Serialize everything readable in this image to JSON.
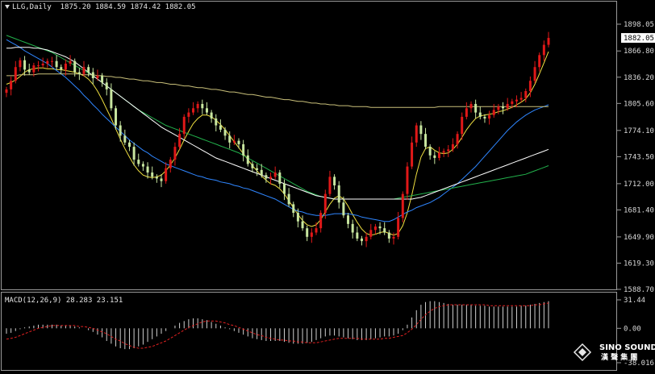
{
  "header": {
    "symbol": "LLG,Daily",
    "ohlc": "1875.20 1884.59 1874.42 1882.05"
  },
  "macd": {
    "label": "MACD(12,26,9) 28.283 23.151",
    "ticks": [
      "31.44",
      "0.00",
      "-38.016"
    ],
    "values": [
      31.44,
      0.0,
      -38.016
    ]
  },
  "price_axis": {
    "ticks": [
      "1898.05",
      "1866.80",
      "1836.20",
      "1805.60",
      "1774.10",
      "1743.50",
      "1712.00",
      "1681.40",
      "1649.90",
      "1619.30",
      "1588.70"
    ],
    "last_price": "1882.05"
  },
  "watermark": {
    "line1": "SINO SOUND",
    "line2": "漢 聲 集 團"
  },
  "colors": {
    "background": "#000000",
    "bull": "#e01818",
    "bear": "#c8e6a0",
    "ma_a": "#f0e040",
    "ma_b": "#2f86ff",
    "ma_c": "#22b24c",
    "ma_d": "#ffffff",
    "ma_e": "#c9c07a",
    "signal": "#e02020",
    "histogram": "#d0d0d0"
  },
  "chart_data": {
    "type": "candlestick",
    "title": "LLG,Daily",
    "ylim": [
      1588.7,
      1898.05
    ],
    "y_ticks": [
      1898.05,
      1866.8,
      1836.2,
      1805.6,
      1774.1,
      1743.5,
      1712.0,
      1681.4,
      1649.9,
      1619.3,
      1588.7
    ],
    "closes": [
      1822,
      1832,
      1848,
      1856,
      1845,
      1842,
      1850,
      1850,
      1852,
      1855,
      1855,
      1848,
      1845,
      1852,
      1855,
      1842,
      1840,
      1848,
      1842,
      1835,
      1838,
      1830,
      1822,
      1800,
      1780,
      1768,
      1760,
      1755,
      1740,
      1735,
      1732,
      1725,
      1720,
      1718,
      1715,
      1730,
      1740,
      1755,
      1770,
      1790,
      1795,
      1800,
      1805,
      1800,
      1795,
      1788,
      1780,
      1775,
      1768,
      1760,
      1762,
      1758,
      1745,
      1735,
      1730,
      1728,
      1722,
      1718,
      1720,
      1725,
      1712,
      1700,
      1688,
      1678,
      1668,
      1660,
      1650,
      1655,
      1660,
      1678,
      1700,
      1720,
      1710,
      1690,
      1675,
      1665,
      1655,
      1648,
      1645,
      1650,
      1658,
      1662,
      1660,
      1655,
      1648,
      1650,
      1672,
      1700,
      1732,
      1760,
      1780,
      1770,
      1755,
      1745,
      1742,
      1748,
      1750,
      1752,
      1758,
      1770,
      1790,
      1800,
      1805,
      1795,
      1790,
      1788,
      1792,
      1798,
      1802,
      1800,
      1805,
      1808,
      1810,
      1812,
      1820,
      1832,
      1848,
      1862,
      1874,
      1882
    ],
    "ma_series": [
      {
        "values": [
          1828,
          1830,
          1833,
          1837,
          1842,
          1845,
          1846,
          1847,
          1847,
          1846,
          1846,
          1845,
          1845,
          1844,
          1843,
          1842,
          1840,
          1838,
          1834,
          1828,
          1820,
          1810,
          1799,
          1788,
          1776,
          1764,
          1753,
          1743,
          1734,
          1727,
          1722,
          1720,
          1719,
          1720,
          1722,
          1727,
          1734,
          1742,
          1752,
          1763,
          1773,
          1782,
          1788,
          1792,
          1792,
          1790,
          1786,
          1781,
          1775,
          1768,
          1761,
          1754,
          1747,
          1740,
          1733,
          1727,
          1721,
          1716,
          1712,
          1710,
          1706,
          1700,
          1692,
          1684,
          1676,
          1669,
          1664,
          1662,
          1664,
          1670,
          1679,
          1688,
          1695,
          1698,
          1694,
          1686,
          1676,
          1667,
          1659,
          1654,
          1652,
          1653,
          1655,
          1656,
          1654,
          1652,
          1654,
          1663,
          1678,
          1699,
          1723,
          1743,
          1753,
          1755,
          1751,
          1748,
          1747,
          1748,
          1752,
          1758,
          1766,
          1775,
          1782,
          1788,
          1791,
          1792,
          1793,
          1794,
          1796,
          1797,
          1799,
          1801,
          1804,
          1807,
          1811,
          1818,
          1828,
          1840,
          1853,
          1866
        ]
      },
      {
        "values": [
          1880,
          1877,
          1874,
          1871,
          1867,
          1864,
          1861,
          1858,
          1855,
          1852,
          1848,
          1844,
          1840,
          1836,
          1831,
          1826,
          1821,
          1815,
          1810,
          1804,
          1799,
          1793,
          1788,
          1783,
          1778,
          1773,
          1768,
          1763,
          1759,
          1755,
          1751,
          1748,
          1744,
          1741,
          1738,
          1735,
          1733,
          1731,
          1729,
          1727,
          1725,
          1723,
          1721,
          1720,
          1718,
          1717,
          1716,
          1714,
          1713,
          1712,
          1710,
          1709,
          1707,
          1706,
          1704,
          1702,
          1700,
          1698,
          1696,
          1694,
          1691,
          1688,
          1685,
          1682,
          1680,
          1679,
          1677,
          1676,
          1675,
          1675,
          1675,
          1676,
          1677,
          1677,
          1677,
          1677,
          1676,
          1675,
          1673,
          1672,
          1671,
          1670,
          1669,
          1668,
          1668,
          1670,
          1673,
          1676,
          1679,
          1681,
          1684,
          1686,
          1688,
          1690,
          1693,
          1696,
          1700,
          1704,
          1708,
          1712,
          1717,
          1722,
          1727,
          1732,
          1738,
          1744,
          1750,
          1756,
          1762,
          1768,
          1774,
          1779,
          1784,
          1788,
          1792,
          1795,
          1798,
          1800,
          1802,
          1804
        ]
      },
      {
        "values": [
          1885,
          1883,
          1881,
          1879,
          1877,
          1875,
          1873,
          1871,
          1869,
          1867,
          1865,
          1862,
          1859,
          1856,
          1853,
          1850,
          1847,
          1844,
          1841,
          1838,
          1834,
          1830,
          1826,
          1822,
          1818,
          1814,
          1810,
          1806,
          1802,
          1798,
          1795,
          1792,
          1789,
          1786,
          1783,
          1780,
          1778,
          1776,
          1774,
          1772,
          1770,
          1768,
          1766,
          1764,
          1762,
          1760,
          1758,
          1756,
          1754,
          1752,
          1750,
          1748,
          1745,
          1742,
          1739,
          1736,
          1733,
          1730,
          1727,
          1724,
          1721,
          1718,
          1715,
          1712,
          1709,
          1706,
          1703,
          1701,
          1699,
          1697,
          1696,
          1695,
          1694,
          1694,
          1694,
          1694,
          1694,
          1694,
          1694,
          1694,
          1694,
          1694,
          1694,
          1694,
          1694,
          1694,
          1695,
          1696,
          1697,
          1698,
          1699,
          1700,
          1701,
          1702,
          1703,
          1704,
          1705,
          1706,
          1707,
          1708,
          1709,
          1710,
          1711,
          1712,
          1713,
          1714,
          1715,
          1716,
          1717,
          1718,
          1719,
          1720,
          1721,
          1722,
          1723,
          1725,
          1727,
          1729,
          1731,
          1733
        ]
      },
      {
        "values": [
          1870,
          1870,
          1871,
          1871,
          1871,
          1871,
          1870,
          1870,
          1869,
          1868,
          1866,
          1864,
          1862,
          1860,
          1857,
          1854,
          1850,
          1846,
          1842,
          1838,
          1834,
          1830,
          1826,
          1822,
          1818,
          1814,
          1810,
          1806,
          1802,
          1798,
          1794,
          1790,
          1786,
          1782,
          1778,
          1775,
          1772,
          1769,
          1766,
          1763,
          1760,
          1757,
          1754,
          1751,
          1748,
          1745,
          1742,
          1740,
          1738,
          1736,
          1734,
          1732,
          1730,
          1728,
          1726,
          1724,
          1722,
          1720,
          1718,
          1716,
          1714,
          1712,
          1710,
          1708,
          1706,
          1704,
          1702,
          1700,
          1698,
          1697,
          1696,
          1695,
          1694,
          1694,
          1694,
          1694,
          1694,
          1694,
          1694,
          1694,
          1694,
          1694,
          1694,
          1694,
          1694,
          1694,
          1694,
          1694,
          1694,
          1694,
          1695,
          1696,
          1698,
          1700,
          1702,
          1704,
          1706,
          1708,
          1710,
          1712,
          1714,
          1716,
          1718,
          1720,
          1722,
          1724,
          1726,
          1728,
          1730,
          1732,
          1734,
          1736,
          1738,
          1740,
          1742,
          1744,
          1746,
          1748,
          1750,
          1752
        ]
      },
      {
        "values": [
          1838,
          1838,
          1838,
          1839,
          1839,
          1839,
          1839,
          1840,
          1840,
          1840,
          1840,
          1840,
          1840,
          1840,
          1840,
          1840,
          1840,
          1839,
          1839,
          1839,
          1838,
          1838,
          1837,
          1837,
          1836,
          1836,
          1835,
          1834,
          1834,
          1833,
          1832,
          1832,
          1831,
          1830,
          1830,
          1829,
          1828,
          1828,
          1827,
          1826,
          1826,
          1825,
          1824,
          1824,
          1823,
          1822,
          1822,
          1821,
          1820,
          1819,
          1819,
          1818,
          1817,
          1816,
          1816,
          1815,
          1814,
          1813,
          1813,
          1812,
          1811,
          1810,
          1810,
          1809,
          1808,
          1808,
          1807,
          1806,
          1806,
          1805,
          1805,
          1804,
          1804,
          1803,
          1803,
          1803,
          1802,
          1802,
          1802,
          1802,
          1801,
          1801,
          1801,
          1801,
          1801,
          1801,
          1801,
          1801,
          1801,
          1801,
          1801,
          1801,
          1801,
          1801,
          1801,
          1802,
          1802,
          1802,
          1802,
          1802,
          1802,
          1802,
          1802,
          1802,
          1802,
          1802,
          1802,
          1802,
          1802,
          1802,
          1802,
          1802,
          1802,
          1802,
          1802,
          1802,
          1802,
          1802,
          1802,
          1802
        ]
      }
    ],
    "macd_histogram": [
      -6,
      -5,
      -3,
      -1,
      1,
      2,
      3,
      4,
      4,
      4,
      4,
      4,
      3,
      3,
      3,
      2,
      1,
      0,
      -2,
      -4,
      -7,
      -10,
      -14,
      -17,
      -20,
      -22,
      -23,
      -23,
      -22,
      -20,
      -18,
      -15,
      -12,
      -9,
      -6,
      -3,
      0,
      3,
      6,
      8,
      10,
      11,
      11,
      10,
      9,
      7,
      5,
      3,
      1,
      -1,
      -3,
      -5,
      -7,
      -9,
      -11,
      -12,
      -13,
      -14,
      -14,
      -14,
      -14,
      -15,
      -16,
      -17,
      -17,
      -17,
      -16,
      -15,
      -13,
      -11,
      -9,
      -8,
      -8,
      -9,
      -10,
      -11,
      -12,
      -13,
      -13,
      -13,
      -12,
      -11,
      -10,
      -9,
      -9,
      -8,
      -6,
      -2,
      4,
      12,
      20,
      26,
      29,
      30,
      30,
      29,
      28,
      27,
      26,
      26,
      26,
      26,
      26,
      25,
      25,
      25,
      24,
      24,
      24,
      24,
      24,
      24,
      24,
      25,
      25,
      26,
      27,
      28,
      29,
      30
    ],
    "macd_signal": [
      -12,
      -11,
      -10,
      -8,
      -6,
      -4,
      -2,
      0,
      1,
      2,
      3,
      3,
      3,
      3,
      3,
      3,
      2,
      2,
      1,
      0,
      -2,
      -4,
      -6,
      -9,
      -12,
      -14,
      -17,
      -19,
      -21,
      -22,
      -22,
      -21,
      -20,
      -18,
      -16,
      -14,
      -11,
      -8,
      -5,
      -2,
      1,
      3,
      5,
      7,
      8,
      8,
      8,
      7,
      6,
      4,
      3,
      1,
      -1,
      -3,
      -5,
      -7,
      -8,
      -10,
      -11,
      -12,
      -13,
      -13,
      -14,
      -14,
      -15,
      -15,
      -16,
      -16,
      -16,
      -15,
      -14,
      -13,
      -12,
      -11,
      -11,
      -11,
      -11,
      -11,
      -12,
      -12,
      -12,
      -12,
      -12,
      -11,
      -11,
      -10,
      -9,
      -8,
      -5,
      -1,
      4,
      10,
      15,
      19,
      22,
      24,
      25,
      26,
      26,
      26,
      26,
      26,
      26,
      26,
      26,
      26,
      25,
      25,
      25,
      25,
      25,
      25,
      25,
      25,
      25,
      25,
      26,
      26,
      27,
      28
    ]
  }
}
